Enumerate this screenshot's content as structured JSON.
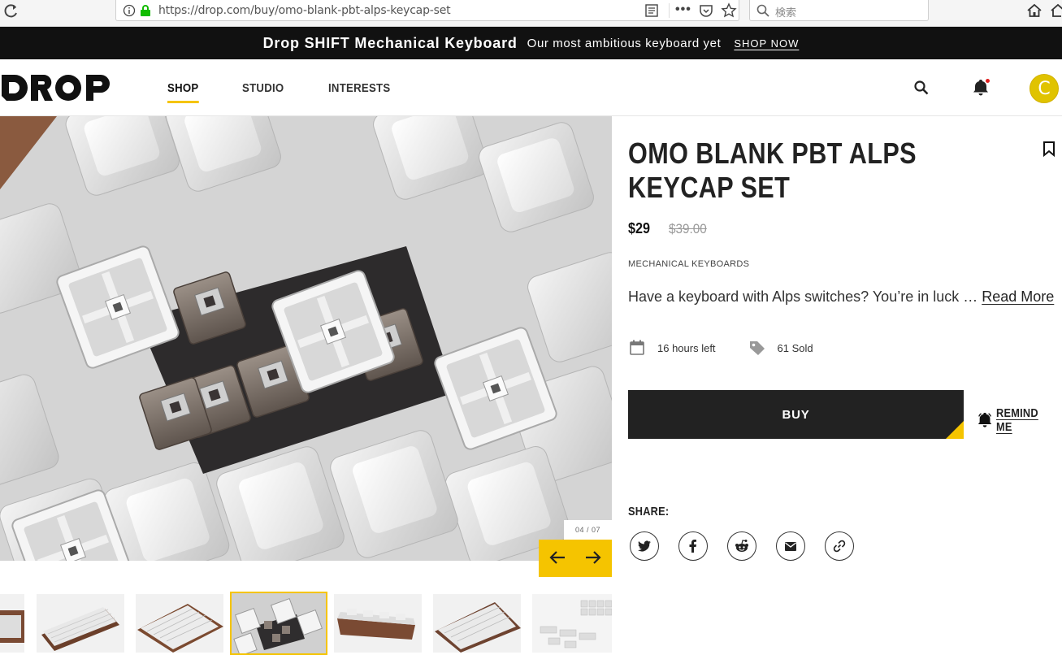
{
  "browser": {
    "url": "https://drop.com/buy/omo-blank-pbt-alps-keycap-set",
    "search_placeholder": "検索",
    "menu_dots": "•••"
  },
  "announcement": {
    "title": "Drop SHIFT Mechanical Keyboard",
    "subtitle": "Our most ambitious keyboard yet",
    "link": "SHOP NOW"
  },
  "header": {
    "logo": "DROP",
    "nav": [
      "SHOP",
      "STUDIO",
      "INTERESTS"
    ],
    "active_nav": "SHOP",
    "avatar_initial": "C"
  },
  "gallery": {
    "counter": "04 / 07",
    "selected_index": 3
  },
  "product": {
    "title": "OMO BLANK PBT ALPS KEYCAP SET",
    "price": "$29",
    "msrp": "$39.00",
    "category": "MECHANICAL KEYBOARDS",
    "description": "Have a keyboard with Alps switches? You’re in luck …",
    "read_more": "Read More",
    "time_left": "16 hours left",
    "sold": "61 Sold",
    "buy_label": "BUY",
    "remind_label": "REMIND ME",
    "share_label": "SHARE:"
  },
  "colors": {
    "accent": "#f5c400",
    "dark": "#222222",
    "announcement_bg": "#111111"
  },
  "icons": {
    "share": [
      "twitter-icon",
      "facebook-icon",
      "reddit-icon",
      "email-icon",
      "link-icon"
    ]
  }
}
